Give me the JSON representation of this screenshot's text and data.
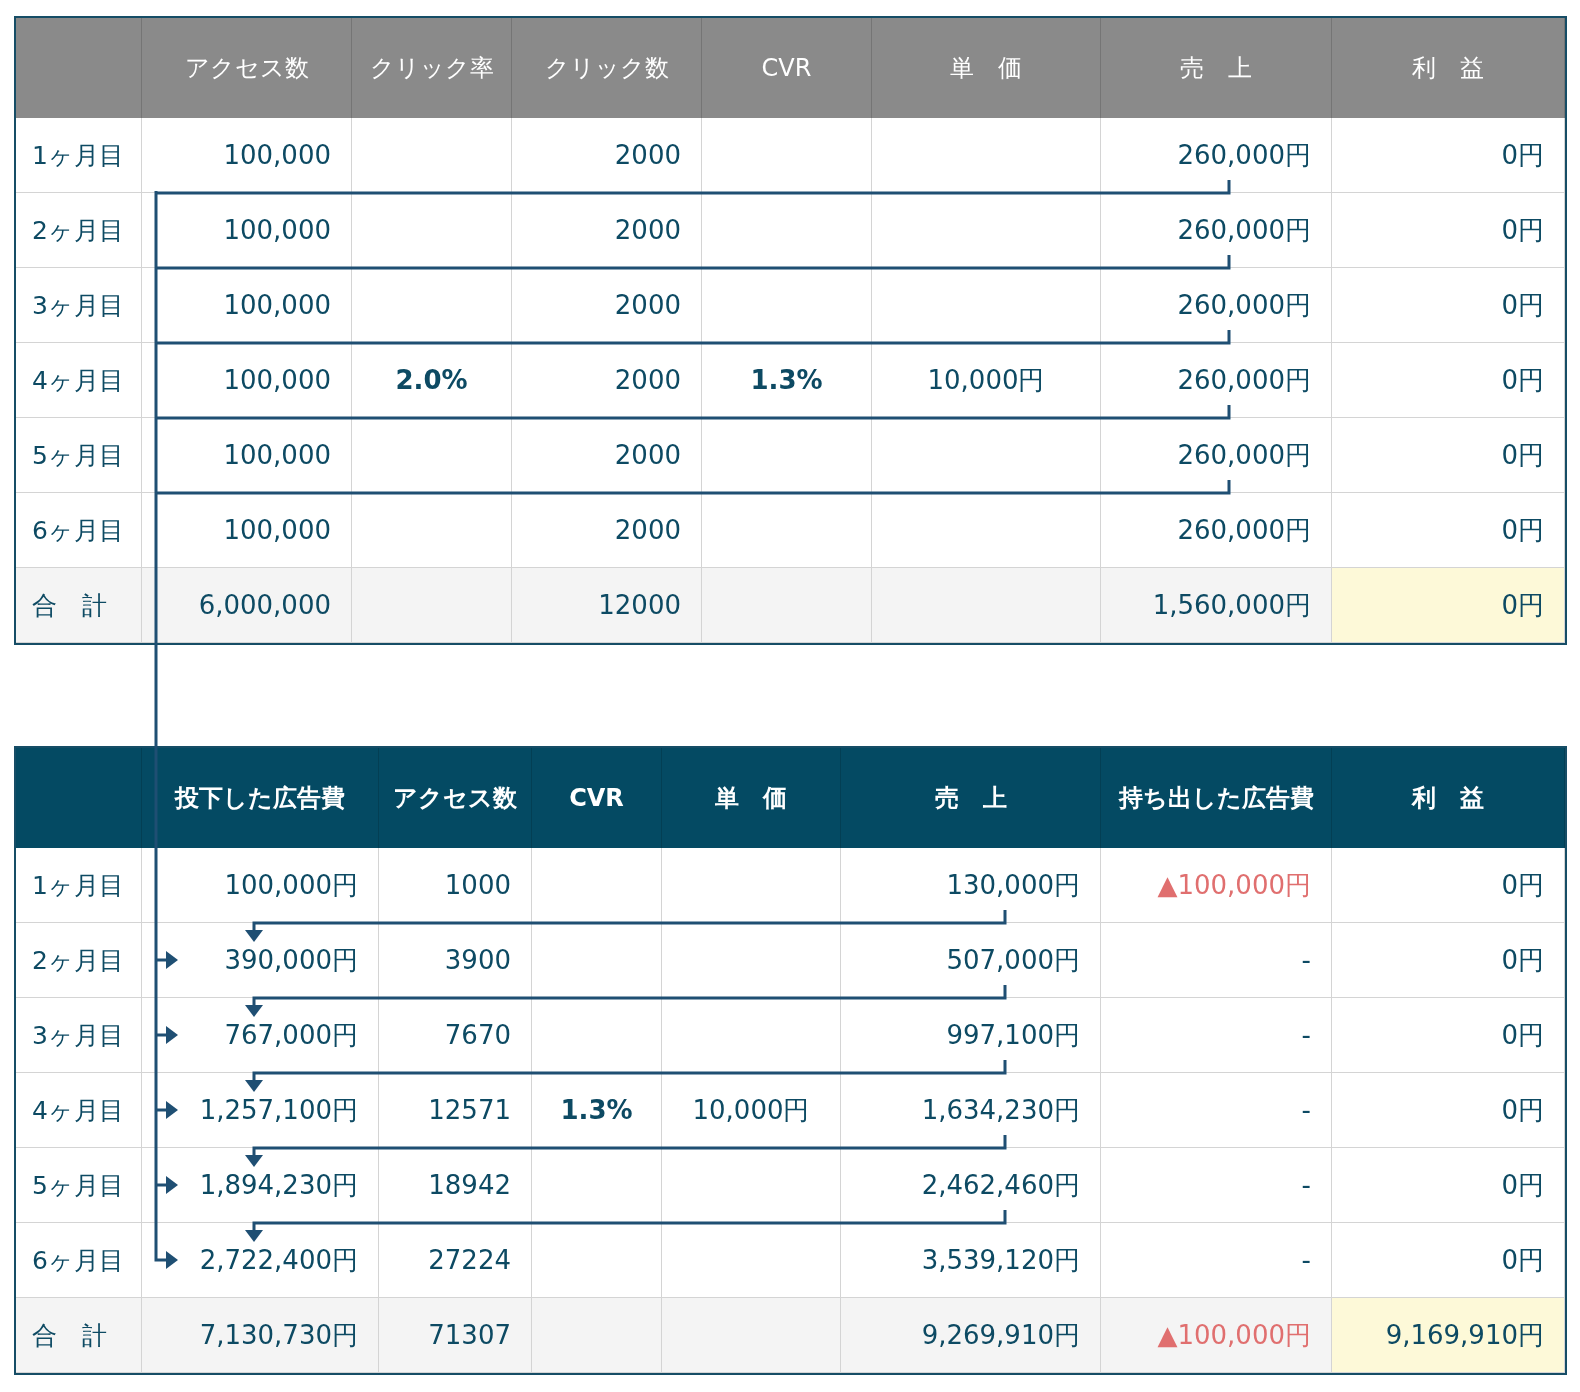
{
  "tables": [
    {
      "kind": "gray",
      "columns": [
        "アクセス数",
        "クリック率",
        "クリック数",
        "CVR",
        "単　価",
        "売　上",
        "利　益"
      ],
      "rows": [
        {
          "label": "1ヶ月目",
          "kind": "month",
          "cells": [
            {
              "kind": "num",
              "text": "100,000"
            },
            null,
            {
              "kind": "num",
              "text": "2000"
            },
            null,
            null,
            {
              "kind": "num",
              "text": "260,000円"
            },
            {
              "kind": "num",
              "text": "0円"
            }
          ]
        },
        {
          "label": "2ヶ月目",
          "kind": "month",
          "cells": [
            {
              "kind": "num",
              "text": "100,000"
            },
            null,
            {
              "kind": "num",
              "text": "2000"
            },
            null,
            null,
            {
              "kind": "num",
              "text": "260,000円"
            },
            {
              "kind": "num",
              "text": "0円"
            }
          ]
        },
        {
          "label": "3ヶ月目",
          "kind": "month",
          "cells": [
            {
              "kind": "num",
              "text": "100,000"
            },
            null,
            {
              "kind": "num",
              "text": "2000"
            },
            null,
            null,
            {
              "kind": "num",
              "text": "260,000円"
            },
            {
              "kind": "num",
              "text": "0円"
            }
          ]
        },
        {
          "label": "4ヶ月目",
          "kind": "month",
          "cells": [
            {
              "kind": "num",
              "text": "100,000"
            },
            {
              "kind": "strong",
              "text": "2.0%"
            },
            {
              "kind": "num",
              "text": "2000"
            },
            {
              "kind": "strong",
              "text": "1.3%"
            },
            {
              "kind": "mid",
              "text": "10,000円"
            },
            {
              "kind": "num",
              "text": "260,000円"
            },
            {
              "kind": "num",
              "text": "0円"
            }
          ]
        },
        {
          "label": "5ヶ月目",
          "kind": "month",
          "cells": [
            {
              "kind": "num",
              "text": "100,000"
            },
            null,
            {
              "kind": "num",
              "text": "2000"
            },
            null,
            null,
            {
              "kind": "num",
              "text": "260,000円"
            },
            {
              "kind": "num",
              "text": "0円"
            }
          ]
        },
        {
          "label": "6ヶ月目",
          "kind": "month",
          "cells": [
            {
              "kind": "num",
              "text": "100,000"
            },
            null,
            {
              "kind": "num",
              "text": "2000"
            },
            null,
            null,
            {
              "kind": "num",
              "text": "260,000円"
            },
            {
              "kind": "num",
              "text": "0円"
            }
          ]
        },
        {
          "label": "合　計",
          "kind": "total",
          "cells": [
            {
              "kind": "num",
              "text": "6,000,000"
            },
            null,
            {
              "kind": "num",
              "text": "12000"
            },
            null,
            null,
            {
              "kind": "num",
              "text": "1,560,000円"
            },
            {
              "kind": "highlight",
              "text": "0円"
            }
          ]
        }
      ]
    },
    {
      "kind": "teal",
      "columns": [
        "投下した広告費",
        "アクセス数",
        "CVR",
        "単　価",
        "売　上",
        "持ち出した広告費",
        "利　益"
      ],
      "rows": [
        {
          "label": "1ヶ月目",
          "kind": "month",
          "cells": [
            {
              "kind": "num",
              "text": "100,000円"
            },
            {
              "kind": "num",
              "text": "1000"
            },
            null,
            null,
            {
              "kind": "num",
              "text": "130,000円"
            },
            {
              "kind": "loss",
              "text": "▲100,000円"
            },
            {
              "kind": "num",
              "text": "0円"
            }
          ]
        },
        {
          "label": "2ヶ月目",
          "kind": "month",
          "cells": [
            {
              "kind": "num",
              "text": "390,000円"
            },
            {
              "kind": "num",
              "text": "3900"
            },
            null,
            null,
            {
              "kind": "num",
              "text": "507,000円"
            },
            {
              "kind": "num",
              "text": "-"
            },
            {
              "kind": "num",
              "text": "0円"
            }
          ]
        },
        {
          "label": "3ヶ月目",
          "kind": "month",
          "cells": [
            {
              "kind": "num",
              "text": "767,000円"
            },
            {
              "kind": "num",
              "text": "7670"
            },
            null,
            null,
            {
              "kind": "num",
              "text": "997,100円"
            },
            {
              "kind": "num",
              "text": "-"
            },
            {
              "kind": "num",
              "text": "0円"
            }
          ]
        },
        {
          "label": "4ヶ月目",
          "kind": "month",
          "cells": [
            {
              "kind": "num",
              "text": "1,257,100円"
            },
            {
              "kind": "num",
              "text": "12571"
            },
            {
              "kind": "strong",
              "text": "1.3%"
            },
            {
              "kind": "mid",
              "text": "10,000円"
            },
            {
              "kind": "num",
              "text": "1,634,230円"
            },
            {
              "kind": "num",
              "text": "-"
            },
            {
              "kind": "num",
              "text": "0円"
            }
          ]
        },
        {
          "label": "5ヶ月目",
          "kind": "month",
          "cells": [
            {
              "kind": "num",
              "text": "1,894,230円"
            },
            {
              "kind": "num",
              "text": "18942"
            },
            null,
            null,
            {
              "kind": "num",
              "text": "2,462,460円"
            },
            {
              "kind": "num",
              "text": "-"
            },
            {
              "kind": "num",
              "text": "0円"
            }
          ]
        },
        {
          "label": "6ヶ月目",
          "kind": "month",
          "cells": [
            {
              "kind": "num",
              "text": "2,722,400円"
            },
            {
              "kind": "num",
              "text": "27224"
            },
            null,
            null,
            {
              "kind": "num",
              "text": "3,539,120円"
            },
            {
              "kind": "num",
              "text": "-"
            },
            {
              "kind": "num",
              "text": "0円"
            }
          ]
        },
        {
          "label": "合　計",
          "kind": "total",
          "cells": [
            {
              "kind": "num",
              "text": "7,130,730円"
            },
            {
              "kind": "num",
              "text": "71307"
            },
            null,
            null,
            {
              "kind": "num",
              "text": "9,269,910円"
            },
            {
              "kind": "loss",
              "text": "▲100,000円"
            },
            {
              "kind": "highlight",
              "text": "9,169,910円"
            }
          ]
        }
      ]
    }
  ]
}
